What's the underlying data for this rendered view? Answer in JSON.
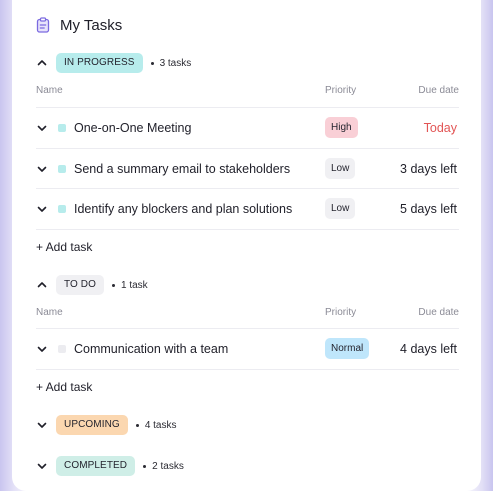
{
  "header": {
    "icon": "clipboard-icon",
    "title": "My Tasks"
  },
  "colors": {
    "in_progress_badge": "#b7ecec",
    "todo_badge": "#f0f0f3",
    "upcoming_badge": "#fbd7b0",
    "completed_badge": "#cfeee7",
    "high_priority": "#f9cfd6",
    "low_priority": "#f0f0f3",
    "normal_priority": "#bfe6fb",
    "today_text": "#e25555",
    "in_progress_dot": "#b7ecec",
    "todo_dot": "#ececf0"
  },
  "columns": {
    "name": "Name",
    "priority": "Priority",
    "due": "Due date"
  },
  "groups": {
    "in_progress": {
      "badge": "IN PROGRESS",
      "count": "3 tasks",
      "tasks": [
        {
          "name": "One-on-One Meeting",
          "priority": "High",
          "due": "Today"
        },
        {
          "name": "Send a summary email to stakeholders",
          "priority": "Low",
          "due": "3 days left"
        },
        {
          "name": "Identify any blockers and plan solutions",
          "priority": "Low",
          "due": "5 days left"
        }
      ],
      "add": "+ Add task"
    },
    "todo": {
      "badge": "TO DO",
      "count": "1 task",
      "tasks": [
        {
          "name": "Communication with a team",
          "priority": "Normal",
          "due": "4 days left"
        }
      ],
      "add": "+ Add task"
    },
    "upcoming": {
      "badge": "UPCOMING",
      "count": "4 tasks"
    },
    "completed": {
      "badge": "COMPLETED",
      "count": "2 tasks"
    }
  }
}
